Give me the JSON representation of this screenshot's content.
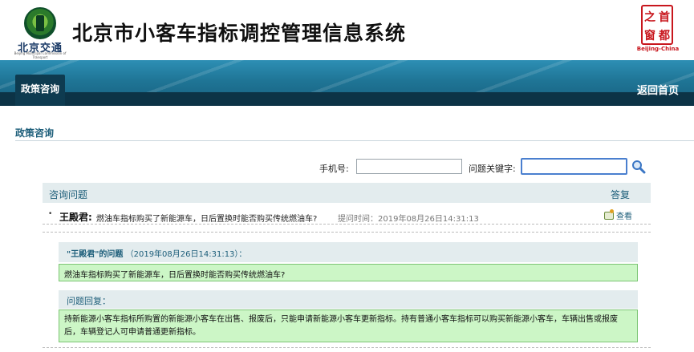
{
  "header": {
    "logo_text": "北京交通",
    "logo_sub": "Beijing Municipal Commission of Transport",
    "title": "北京市小客车指标调控管理信息系统",
    "seal_chars": [
      "之",
      "首",
      "窗",
      "都"
    ],
    "seal_caption": "Beijing-China"
  },
  "nav": {
    "active_tab": "政策咨询",
    "back_link": "返回首页"
  },
  "section": {
    "title": "政策咨询"
  },
  "search": {
    "phone_label": "手机号:",
    "phone_value": "",
    "keyword_label": "问题关键字:",
    "keyword_value": ""
  },
  "table": {
    "col_question": "咨询问题",
    "col_reply": "答复",
    "rows": [
      {
        "asker": "王殿君:",
        "question": "燃油车指标购买了新能源车，日后置换时能否购买传统燃油车?",
        "time": "提问时间：2019年08月26日14:31:13",
        "view": "查看"
      }
    ]
  },
  "detail": {
    "question_title_name": "\"王殿君\"的问题",
    "question_title_time": "（2019年08月26日14:31:13）：",
    "question_text": "燃油车指标购买了新能源车，日后置换时能否购买传统燃油车?",
    "answer_title": "问题回复：",
    "answer_text": "持新能源小客车指标所购置的新能源小客车在出售、报废后，只能申请新能源小客车更新指标。持有普通小客车指标可以购买新能源小客车，车辆出售或报废后，车辆登记人可申请普通更新指标。"
  },
  "colors": {
    "banner": "#1f7596",
    "tab_active": "#0e3b50",
    "accent_text": "#1d5e7a",
    "answer_bg": "#ccf6c6",
    "seal_red": "#c8161d"
  }
}
